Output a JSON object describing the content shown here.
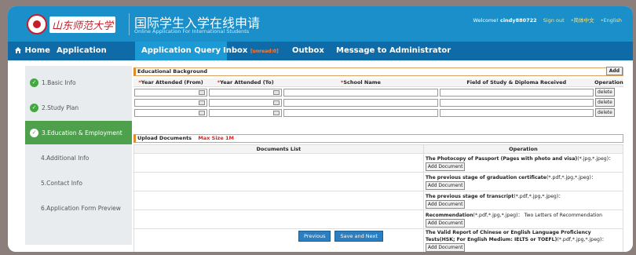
{
  "header": {
    "logo_text": "山东师范大学",
    "title": "国际学生入学在线申请",
    "subtitle": "Online Application For International Students",
    "welcome_prefix": "Welcome!",
    "username": "cindy880722",
    "sign_out": "Sign out",
    "lang_cn": "•简体中文",
    "lang_en": "•English"
  },
  "nav": {
    "home": "Home",
    "items": [
      "Application",
      "Application Query",
      "Inbox",
      "Outbox",
      "Message to Administrator"
    ],
    "unread_badge": "[unread:0]",
    "active": "Application Query"
  },
  "sidebar": {
    "items": [
      {
        "label": "1.Basic Info",
        "status": "complete"
      },
      {
        "label": "2.Study Plan",
        "status": "complete"
      },
      {
        "label": "3.Education & Employment",
        "status": "current"
      },
      {
        "label": "4.Additional Info",
        "status": "pending"
      },
      {
        "label": "5.Contact Info",
        "status": "pending"
      },
      {
        "label": "6.Application Form Preview",
        "status": "pending"
      }
    ]
  },
  "education": {
    "section_title": "Educational Background",
    "add_label": "Add",
    "columns": [
      "Year Attended (From)",
      "Year Attended (To)",
      "School Name",
      "Field of Study & Diploma Received",
      "Operation"
    ],
    "required_mark": "*",
    "delete_label": "delete",
    "row_count": 3
  },
  "documents": {
    "section_title": "Upload Documents",
    "max_size": "Max Size 1M",
    "columns": [
      "Documents List",
      "Operation"
    ],
    "add_doc_label": "Add Document",
    "items": [
      {
        "name": "The Photocopy of Passport (Pages with photo and visa)",
        "formats": "(*.jpg,*.jpeg)：",
        "note": ""
      },
      {
        "name": "The previous stage of graduation certificate",
        "formats": "(*.pdf,*.jpg,*.jpeg)：",
        "note": ""
      },
      {
        "name": "The previous stage of transcript",
        "formats": "(*.pdf,*.jpg,*.jpeg)：",
        "note": ""
      },
      {
        "name": "Recommendation",
        "formats": "(*.pdf,*.jpg,*.jpeg)：",
        "note": "Two Letters of Recommendation"
      },
      {
        "name": "The Valid Report of Chinese or English Language Proficiency Tests(HSK; For English Medium: IELTS or TOEFL)",
        "formats": "(*.pdf,*.jpg,*.jpeg)：",
        "note": ""
      }
    ]
  },
  "footer": {
    "previous": "Previous",
    "save_next": "Save and Next"
  },
  "colors": {
    "header_blue": "#1a8fc9",
    "nav_blue": "#0f6ba8",
    "active_tab": "#1c9ad6",
    "success_green": "#4fa04d",
    "required_red": "#e02020"
  }
}
